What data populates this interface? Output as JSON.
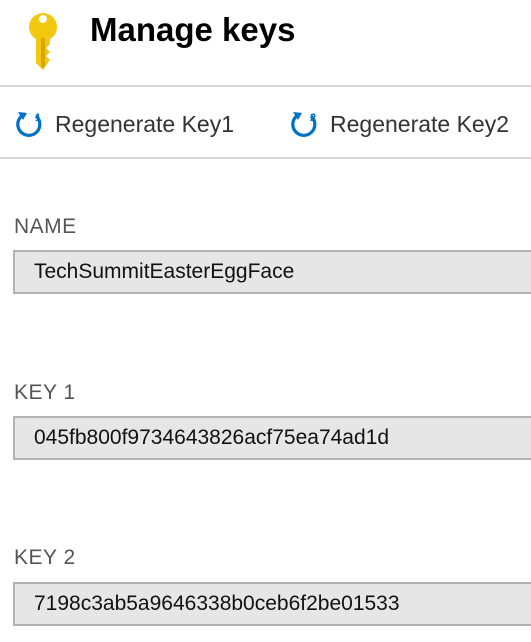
{
  "header": {
    "title": "Manage keys",
    "icon": "key-icon",
    "icon_color": "#f2c811"
  },
  "toolbar": {
    "regen_key1": {
      "label": "Regenerate Key1",
      "icon": "refresh-1-icon"
    },
    "regen_key2": {
      "label": "Regenerate Key2",
      "icon": "refresh-2-icon"
    },
    "icon_color": "#0072c6"
  },
  "fields": {
    "name": {
      "label": "NAME",
      "value": "TechSummitEasterEggFace"
    },
    "key1": {
      "label": "KEY 1",
      "value": "045fb800f9734643826acf75ea74ad1d"
    },
    "key2": {
      "label": "KEY 2",
      "value": "7198c3ab5a9646338b0ceb6f2be01533"
    }
  }
}
